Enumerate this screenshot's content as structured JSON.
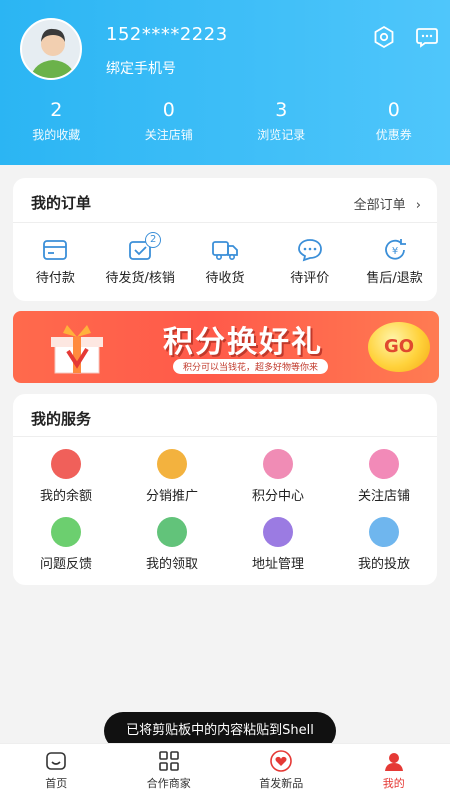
{
  "profile": {
    "phone": "152****2223",
    "bind_text": "绑定手机号"
  },
  "stats": [
    {
      "value": "2",
      "label": "我的收藏"
    },
    {
      "value": "0",
      "label": "关注店铺"
    },
    {
      "value": "3",
      "label": "浏览记录"
    },
    {
      "value": "0",
      "label": "优惠券"
    }
  ],
  "orders": {
    "title": "我的订单",
    "all_label": "全部订单",
    "items": [
      {
        "label": "待付款",
        "icon": "wallet-icon"
      },
      {
        "label": "待发货/核销",
        "icon": "package-icon",
        "badge": "2"
      },
      {
        "label": "待收货",
        "icon": "truck-icon"
      },
      {
        "label": "待评价",
        "icon": "chat-icon"
      },
      {
        "label": "售后/退款",
        "icon": "refund-icon"
      }
    ]
  },
  "banner": {
    "title": "积分换好礼",
    "subtitle": "积分可以当钱花，超多好物等你来",
    "go": "GO"
  },
  "services": {
    "title": "我的服务",
    "items": [
      {
        "label": "我的余额",
        "icon": "piggy-icon",
        "color": "#f0605a"
      },
      {
        "label": "分销推广",
        "icon": "crown-icon",
        "color": "#f3b23e"
      },
      {
        "label": "积分中心",
        "icon": "flower-icon",
        "color": "#f08cb5"
      },
      {
        "label": "关注店铺",
        "icon": "gift-box-icon",
        "color": "#f28ab8"
      },
      {
        "label": "问题反馈",
        "icon": "feedback-icon",
        "color": "#6ccf6f"
      },
      {
        "label": "我的领取",
        "icon": "claim-icon",
        "color": "#62c37a"
      },
      {
        "label": "地址管理",
        "icon": "location-icon",
        "color": "#9b7be2"
      },
      {
        "label": "我的投放",
        "icon": "delivery-icon",
        "color": "#6fb6ee"
      }
    ]
  },
  "toast": "已将剪贴板中的内容粘贴到Shell",
  "tabs": [
    {
      "label": "首页",
      "icon": "home-icon"
    },
    {
      "label": "合作商家",
      "icon": "grid-icon"
    },
    {
      "label": "首发新品",
      "icon": "heart-icon"
    },
    {
      "label": "我的",
      "icon": "profile-icon"
    }
  ],
  "colors": {
    "header": "#2bb5f3",
    "accent": "#e53935",
    "order_icon": "#3b8fd8"
  }
}
